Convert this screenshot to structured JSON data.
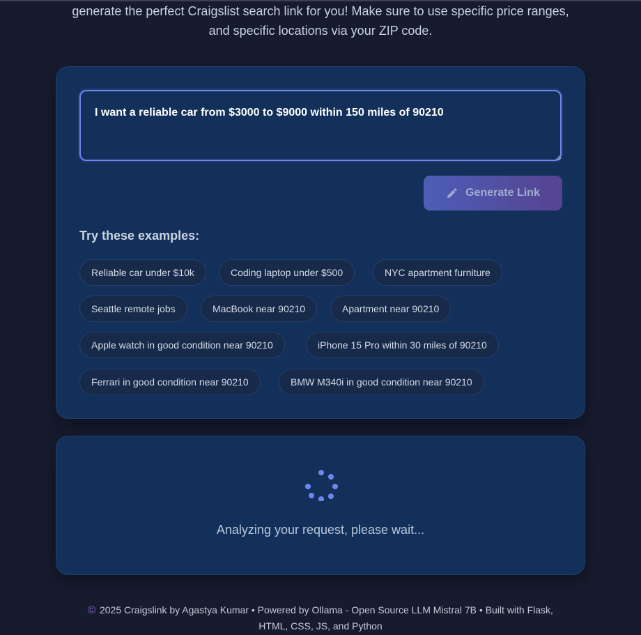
{
  "intro": {
    "line1": "generate the perfect Craigslist search link for you! Make sure to use specific price ranges,",
    "line2": "and specific locations via your ZIP code."
  },
  "query": {
    "value": "I want a reliable car from $3000 to $9000 within 150 miles of 90210"
  },
  "generate_button": {
    "label": "Generate Link",
    "icon": "pencil-icon"
  },
  "examples": {
    "title": "Try these examples:",
    "items": [
      "Reliable car under $10k",
      "Coding laptop under $500",
      "NYC apartment furniture",
      "Seattle remote jobs",
      "MacBook near 90210",
      "Apartment near 90210",
      "Apple watch in good condition near 90210",
      "iPhone 15 Pro within 30 miles of 90210",
      "Ferrari in good condition near 90210",
      "BMW M340i in good condition near 90210"
    ]
  },
  "loading": {
    "text": "Analyzing your request, please wait...",
    "spinner_icon": "spinner-icon",
    "color": "#6f86ee"
  },
  "footer": {
    "symbol": "©",
    "line1": "2025 Craigslink by Agastya Kumar • Powered by Ollama - Open Source LLM Mistral 7B • Built with Flask,",
    "line2": "HTML, CSS, JS, and Python"
  },
  "colors": {
    "background": "#161b2e",
    "card": "#12305a",
    "accent": "#6f86ee",
    "button_gradient_start": "#5866c8",
    "button_gradient_end": "#62479a"
  }
}
